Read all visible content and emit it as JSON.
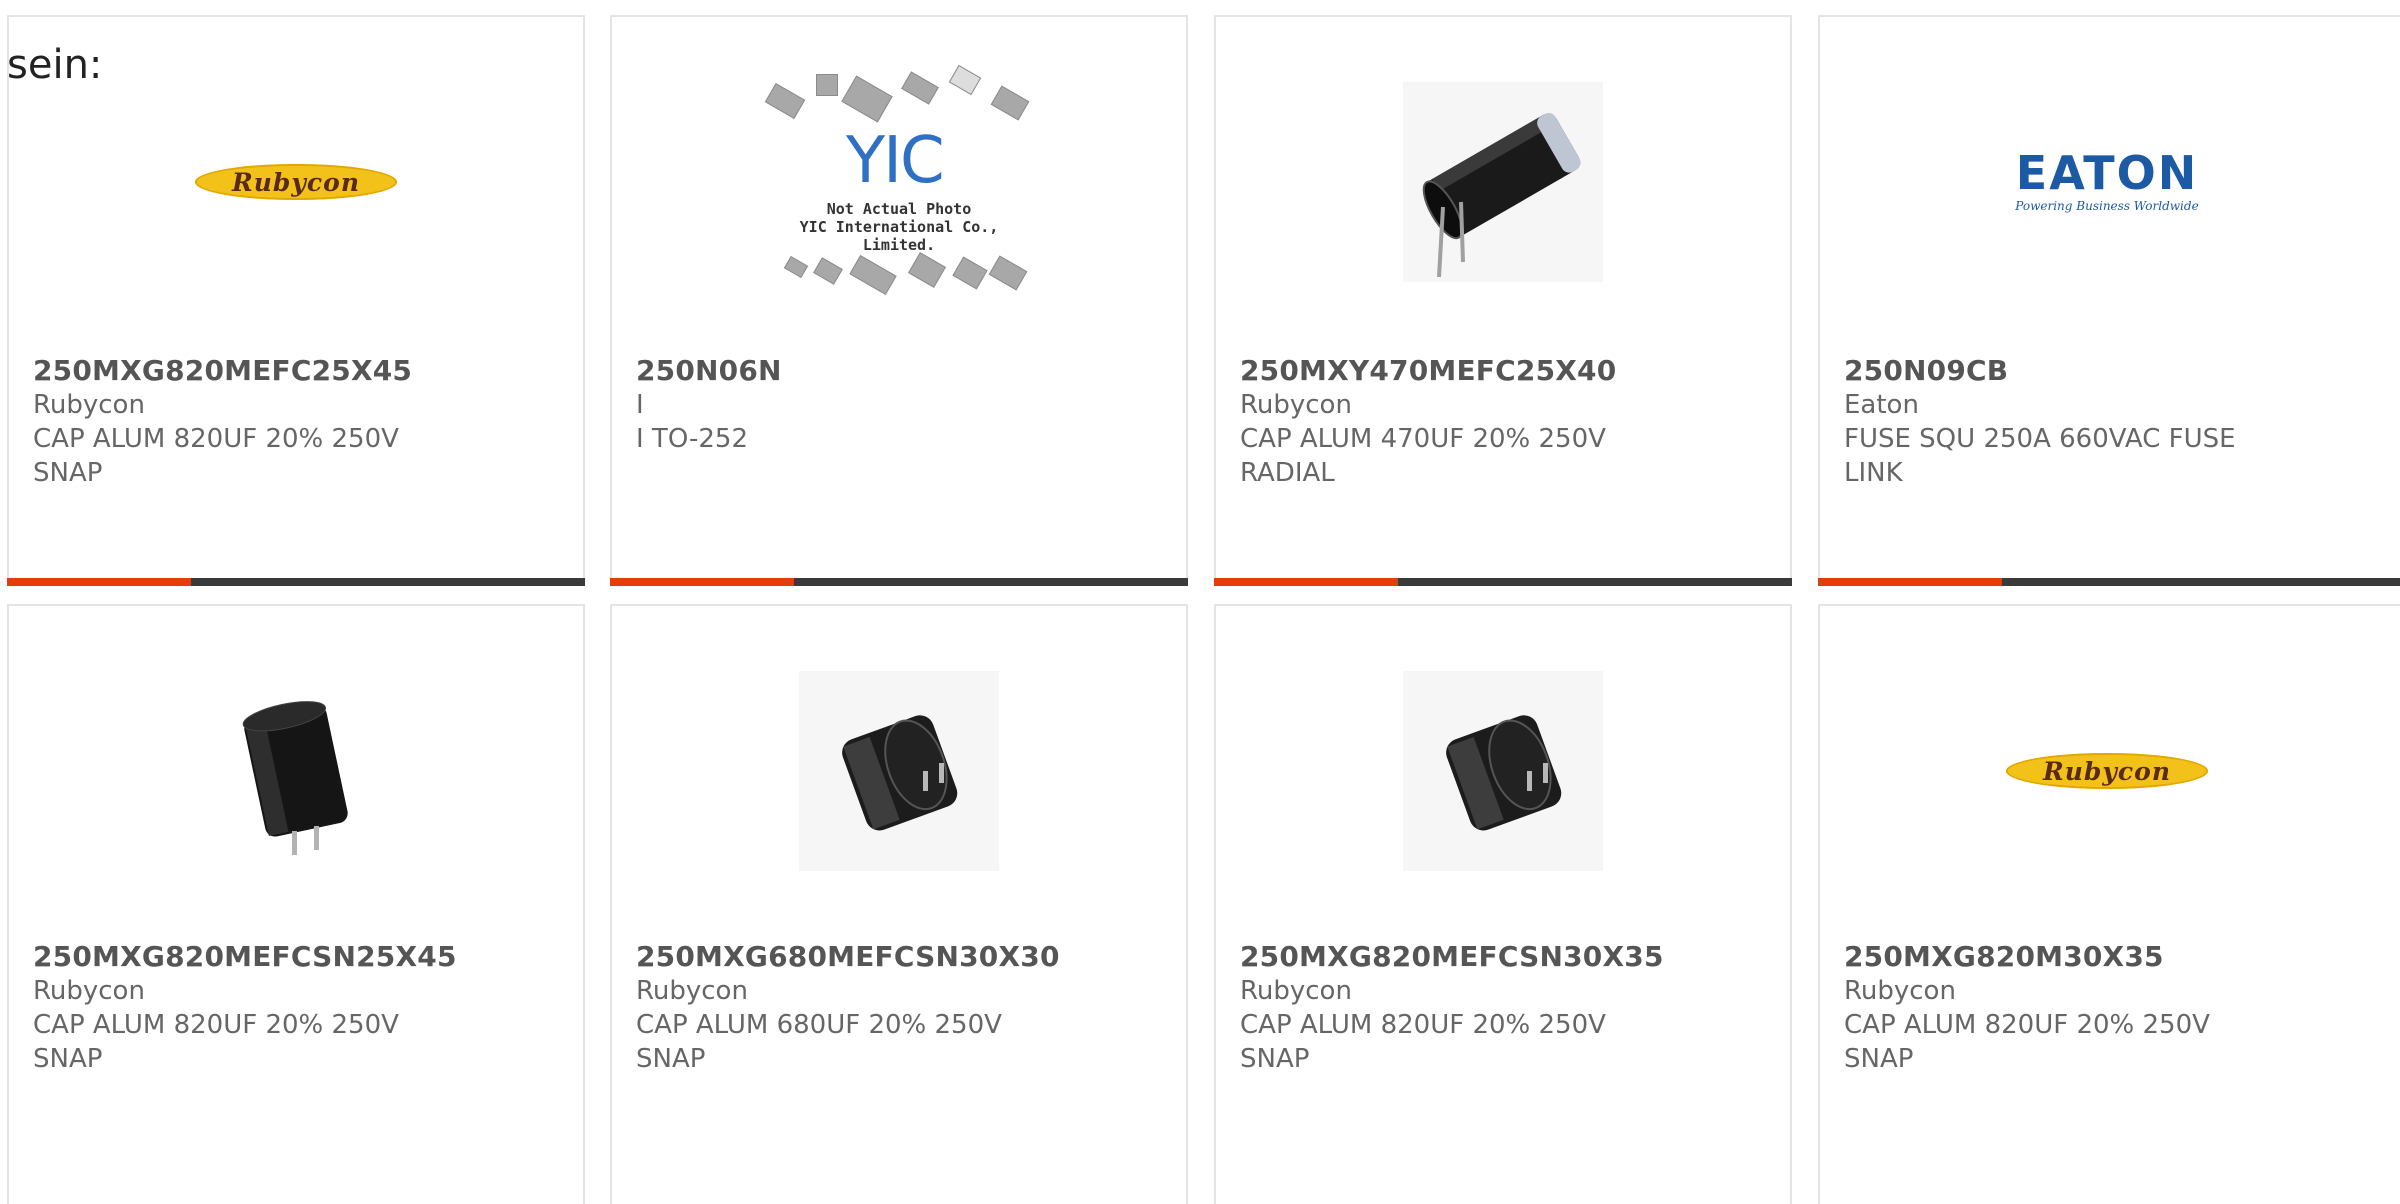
{
  "intro_text": "sein:",
  "products": [
    {
      "part_number": "250MXG820MEFC25X45",
      "manufacturer": "Rubycon",
      "description": "CAP ALUM 820UF 20% 250V SNAP",
      "image": "rubycon-logo"
    },
    {
      "part_number": "250N06N",
      "manufacturer": "I",
      "description": "I TO-252",
      "image": "yic-placeholder"
    },
    {
      "part_number": "250MXY470MEFC25X40",
      "manufacturer": "Rubycon",
      "description": "CAP ALUM 470UF 20% 250V RADIAL",
      "image": "radial-capacitor-photo"
    },
    {
      "part_number": "250N09CB",
      "manufacturer": "Eaton",
      "description": "FUSE SQU 250A 660VAC FUSE LINK",
      "image": "eaton-logo"
    },
    {
      "part_number": "250MXG820MEFCSN25X45",
      "manufacturer": "Rubycon",
      "description": "CAP ALUM 820UF 20% 250V SNAP",
      "image": "snap-capacitor-photo"
    },
    {
      "part_number": "250MXG680MEFCSN30X30",
      "manufacturer": "Rubycon",
      "description": "CAP ALUM 680UF 20% 250V SNAP",
      "image": "snap-capacitor-photo"
    },
    {
      "part_number": "250MXG820MEFCSN30X35",
      "manufacturer": "Rubycon",
      "description": "CAP ALUM 820UF 20% 250V SNAP",
      "image": "snap-capacitor-photo"
    },
    {
      "part_number": "250MXG820M30X35",
      "manufacturer": "Rubycon",
      "description": "CAP ALUM 820UF 20% 250V SNAP",
      "image": "rubycon-logo"
    }
  ],
  "logos": {
    "rubycon": "Rubycon",
    "eaton_word": "EATON",
    "eaton_tagline": "Powering Business Worldwide",
    "yic_mark": "YIC",
    "yic_caption_1": "Not Actual Photo",
    "yic_caption_2": "YIC International Co., Limited."
  },
  "colors": {
    "accent": "#e23d0a",
    "bar": "#3a3a3a",
    "card_border": "#e4e4e4",
    "rubycon_yellow": "#f3c21a",
    "eaton_blue": "#1d5aa5"
  }
}
